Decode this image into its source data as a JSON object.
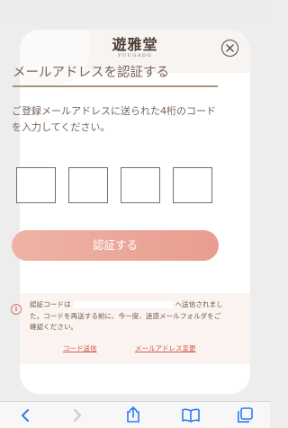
{
  "brand": {
    "logo_text": "遊雅堂",
    "logo_sub": "YUUGADO"
  },
  "modal": {
    "close_icon": "close-circle-icon",
    "title": "メールアドレスを認証する",
    "description": "ご登録メールアドレスに送られた4桁のコードを入力してください。",
    "code_digits": [
      "",
      "",
      "",
      ""
    ],
    "verify_button": "認証する"
  },
  "notice": {
    "icon": "info-icon",
    "text_before": "認証コードは",
    "text_after": "へ送信されました。コードを再送する前に、今一度、迷惑メールフォルダをご確認ください。",
    "resend_link": "コード送信",
    "change_email_link": "メールアドレス変更"
  },
  "browser_toolbar": {
    "icons": [
      "back-icon",
      "forward-icon",
      "share-icon",
      "bookmarks-icon",
      "tabs-icon"
    ]
  },
  "colors": {
    "accent": "#e99d90",
    "link": "#d45a4d",
    "title_rule": "#ab9379"
  }
}
